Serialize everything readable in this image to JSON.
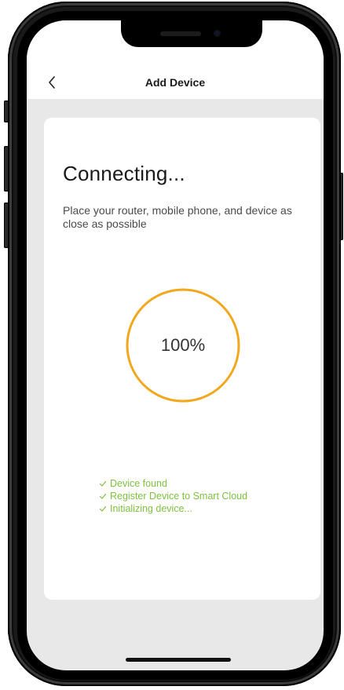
{
  "nav": {
    "title": "Add Device",
    "back_icon": "chevron-left-icon"
  },
  "main": {
    "heading": "Connecting...",
    "description": "Place your router, mobile phone, and device as close as possible",
    "progress_label": "100%",
    "progress_value": 1.0,
    "steps": [
      {
        "label": "Device found",
        "icon": "check-icon"
      },
      {
        "label": "Register Device to Smart Cloud",
        "icon": "check-icon"
      },
      {
        "label": "Initializing device...",
        "icon": "check-icon"
      }
    ]
  },
  "colors": {
    "accent_orange": "#f2a81d",
    "success_green": "#7ec040",
    "background_gray": "#e8e8e8",
    "card_white": "#ffffff"
  }
}
